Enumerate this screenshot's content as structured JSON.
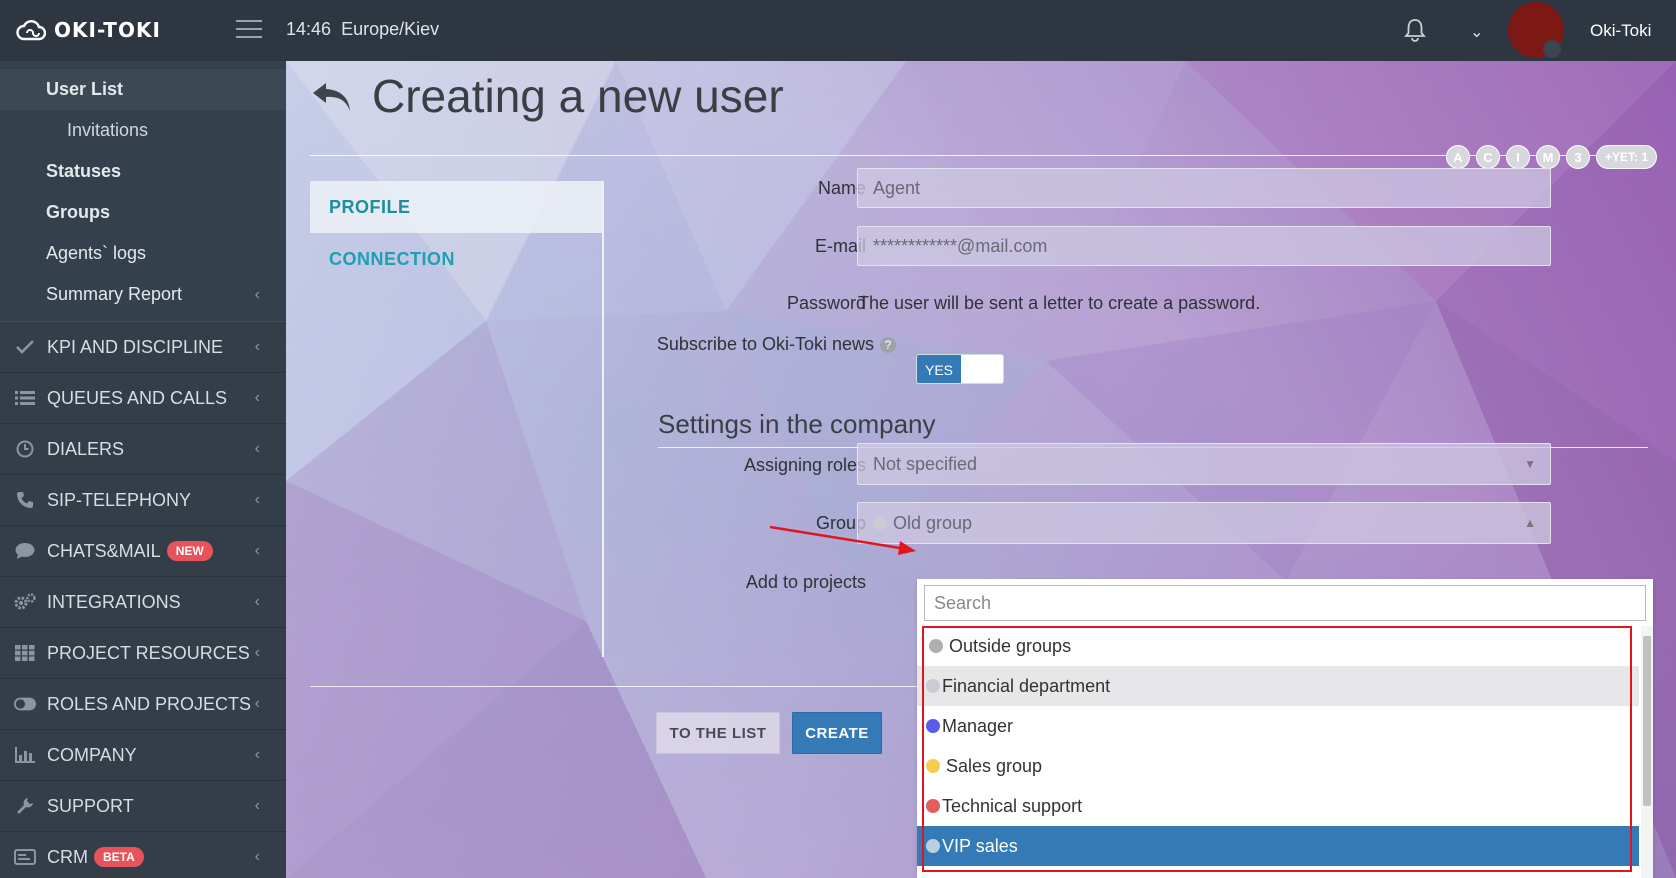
{
  "topbar": {
    "logo_text": "OKI-TOKI",
    "time": "14:46",
    "timezone": "Europe/Kiev",
    "user_name": "Oki-Toki"
  },
  "sidebar": {
    "sub_items": [
      {
        "label": "User List"
      },
      {
        "label": "Invitations"
      },
      {
        "label": "Statuses"
      },
      {
        "label": "Groups"
      },
      {
        "label": "Agents` logs"
      },
      {
        "label": "Summary Report"
      }
    ],
    "sections": [
      {
        "label": "KPI AND DISCIPLINE",
        "icon": "check-icon"
      },
      {
        "label": "QUEUES AND CALLS",
        "icon": "list-icon"
      },
      {
        "label": "DIALERS",
        "icon": "clock-icon"
      },
      {
        "label": "SIP-TELEPHONY",
        "icon": "phone-icon"
      },
      {
        "label": "CHATS&MAIL",
        "icon": "chat-icon",
        "badge": "NEW"
      },
      {
        "label": "INTEGRATIONS",
        "icon": "gears-icon"
      },
      {
        "label": "PROJECT RESOURCES",
        "icon": "grid-icon"
      },
      {
        "label": "ROLES AND PROJECTS",
        "icon": "toggle-icon"
      },
      {
        "label": "COMPANY",
        "icon": "bar-chart-icon"
      },
      {
        "label": "SUPPORT",
        "icon": "wrench-icon"
      },
      {
        "label": "CRM",
        "icon": "crm-icon",
        "badge": "BETA"
      }
    ]
  },
  "main": {
    "title": "Creating a new user",
    "chips": [
      "A",
      "C",
      "I",
      "M",
      "3",
      "+YET: 1"
    ],
    "tabs": [
      {
        "label": "PROFILE"
      },
      {
        "label": "CONNECTION"
      }
    ],
    "form": {
      "name_label": "Name",
      "name_value": "Agent",
      "email_label": "E-mail",
      "email_value": "************@mail.com",
      "password_label": "Password",
      "password_text": "The user will be sent a letter to create a password.",
      "subscribe_label": "Subscribe to Oki-Toki news",
      "help_glyph": "?",
      "toggle_value": "YES",
      "section_title": "Settings in the company",
      "roles_label": "Assigning roles",
      "roles_value": "Not specified",
      "group_label": "Group",
      "group_value": "Old group",
      "projects_label": "Add to projects"
    },
    "buttons": {
      "to_list": "TO THE LIST",
      "create": "CREATE"
    },
    "dropdown": {
      "search_placeholder": "Search",
      "options": [
        {
          "label": "Outside groups",
          "color": "#b0b0b0"
        },
        {
          "label": "Financial department",
          "color": "#c9ccd2"
        },
        {
          "label": "Manager",
          "color": "#5a5cf0"
        },
        {
          "label": "Sales group",
          "color": "#f4cd4d"
        },
        {
          "label": "Technical support",
          "color": "#e45c5c"
        },
        {
          "label": "VIP sales",
          "color": "#b9cfe3"
        }
      ]
    }
  },
  "colors": {
    "accent": "#337ab7",
    "tab_text": "#1f9fb1",
    "annotation": "#e0161f"
  }
}
